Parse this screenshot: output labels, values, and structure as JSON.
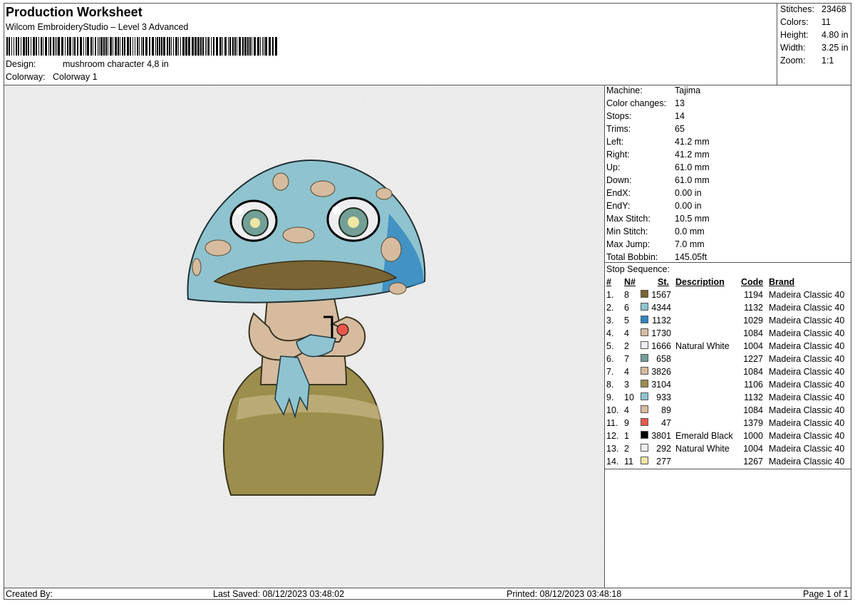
{
  "header": {
    "title": "Production Worksheet",
    "software": "Wilcom EmbroideryStudio – Level 3 Advanced",
    "design_label": "Design:",
    "design_value": "mushroom character 4,8 in",
    "colorway_label": "Colorway:",
    "colorway_value": "Colorway 1"
  },
  "stats": {
    "stitches_label": "Stitches:",
    "stitches": "23468",
    "colors_label": "Colors:",
    "colors": "11",
    "height_label": "Height:",
    "height": "4.80 in",
    "width_label": "Width:",
    "width": "3.25 in",
    "zoom_label": "Zoom:",
    "zoom": "1:1"
  },
  "machine_info": [
    {
      "label": "Machine:",
      "value": "Tajima"
    },
    {
      "label": "Color changes:",
      "value": "13"
    },
    {
      "label": "Stops:",
      "value": "14"
    },
    {
      "label": "Trims:",
      "value": "65"
    },
    {
      "label": "Left:",
      "value": "41.2 mm"
    },
    {
      "label": "Right:",
      "value": "41.2 mm"
    },
    {
      "label": "Up:",
      "value": "61.0 mm"
    },
    {
      "label": "Down:",
      "value": "61.0 mm"
    },
    {
      "label": "EndX:",
      "value": "0.00 in"
    },
    {
      "label": "EndY:",
      "value": "0.00 in"
    },
    {
      "label": "Max Stitch:",
      "value": "10.5 mm"
    },
    {
      "label": "Min Stitch:",
      "value": "0.0 mm"
    },
    {
      "label": "Max Jump:",
      "value": "7.0 mm"
    },
    {
      "label": "Total Bobbin:",
      "value": "145.05ft"
    }
  ],
  "stop_sequence": {
    "title": "Stop Sequence:",
    "columns": {
      "num": "#",
      "n": "N#",
      "st": "St.",
      "description": "Description",
      "code": "Code",
      "brand": "Brand"
    },
    "rows": [
      {
        "num": "1.",
        "n": "8",
        "color": "#7a6433",
        "st": "1567",
        "description": "",
        "code": "1194",
        "brand": "Madeira Classic 40"
      },
      {
        "num": "2.",
        "n": "6",
        "color": "#8ec3cf",
        "st": "4344",
        "description": "",
        "code": "1132",
        "brand": "Madeira Classic 40"
      },
      {
        "num": "3.",
        "n": "5",
        "color": "#2f86c1",
        "st": "1132",
        "description": "",
        "code": "1029",
        "brand": "Madeira Classic 40"
      },
      {
        "num": "4.",
        "n": "4",
        "color": "#d6bb9f",
        "st": "1730",
        "description": "",
        "code": "1084",
        "brand": "Madeira Classic 40"
      },
      {
        "num": "5.",
        "n": "2",
        "color": "#eeeef2",
        "st": "1666",
        "description": "Natural White",
        "code": "1004",
        "brand": "Madeira Classic 40"
      },
      {
        "num": "6.",
        "n": "7",
        "color": "#739f96",
        "st": "658",
        "description": "",
        "code": "1227",
        "brand": "Madeira Classic 40"
      },
      {
        "num": "7.",
        "n": "4",
        "color": "#d6bb9f",
        "st": "3826",
        "description": "",
        "code": "1084",
        "brand": "Madeira Classic 40"
      },
      {
        "num": "8.",
        "n": "3",
        "color": "#9c8e4c",
        "st": "3104",
        "description": "",
        "code": "1106",
        "brand": "Madeira Classic 40"
      },
      {
        "num": "9.",
        "n": "10",
        "color": "#8ec3cf",
        "st": "933",
        "description": "",
        "code": "1132",
        "brand": "Madeira Classic 40"
      },
      {
        "num": "10.",
        "n": "4",
        "color": "#d6bb9f",
        "st": "89",
        "description": "",
        "code": "1084",
        "brand": "Madeira Classic 40"
      },
      {
        "num": "11.",
        "n": "9",
        "color": "#e8574b",
        "st": "47",
        "description": "",
        "code": "1379",
        "brand": "Madeira Classic 40"
      },
      {
        "num": "12.",
        "n": "1",
        "color": "#000000",
        "st": "3801",
        "description": "Emerald Black",
        "code": "1000",
        "brand": "Madeira Classic 40"
      },
      {
        "num": "13.",
        "n": "2",
        "color": "#eeeef2",
        "st": "292",
        "description": "Natural White",
        "code": "1004",
        "brand": "Madeira Classic 40"
      },
      {
        "num": "14.",
        "n": "11",
        "color": "#efe6a4",
        "st": "277",
        "description": "",
        "code": "1267",
        "brand": "Madeira Classic 40"
      }
    ]
  },
  "footer": {
    "created_by": "Created By:",
    "last_saved": "Last Saved: 08/12/2023 03:48:02",
    "printed": "Printed: 08/12/2023 03:48:18",
    "page": "Page 1 of 1"
  }
}
